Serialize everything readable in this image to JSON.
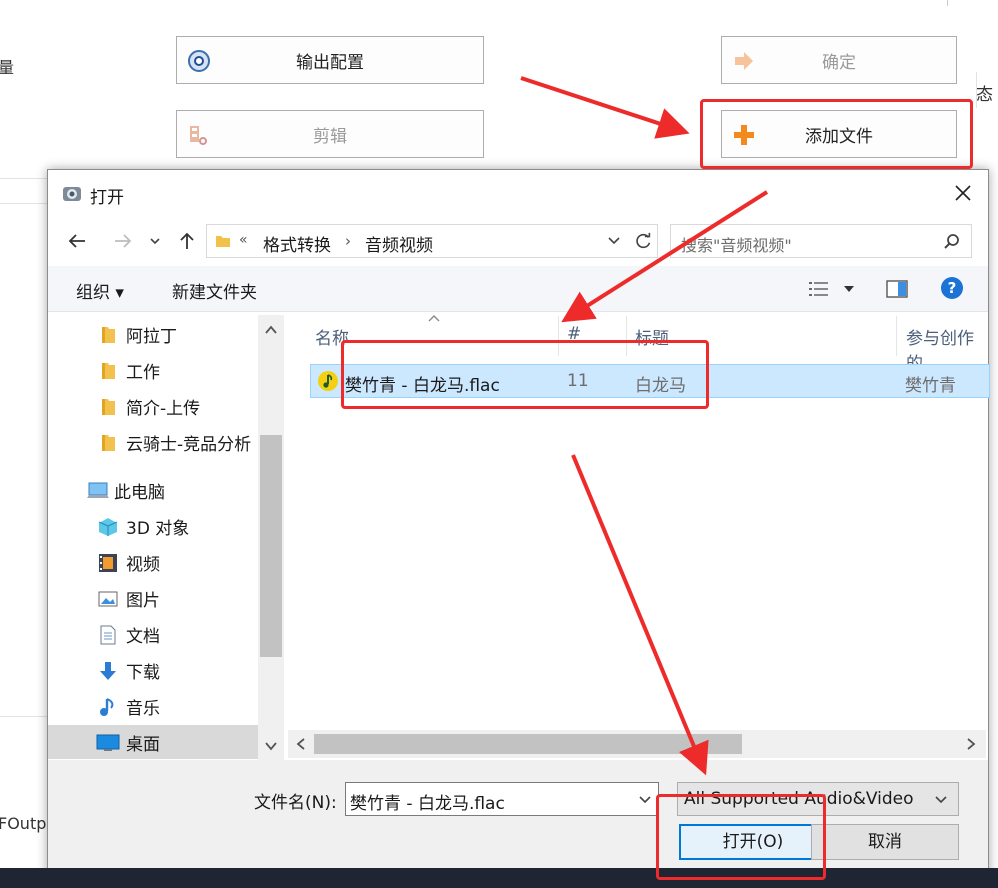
{
  "background_app": {
    "left_fragment_1": "量",
    "left_fragment_2": "",
    "right_fragment": "态",
    "bottom_left_fragment": "FOutpu",
    "buttons": {
      "output_config": "输出配置",
      "confirm": "确定",
      "clip": "剪辑",
      "add_file": "添加文件"
    }
  },
  "dialog": {
    "title": "打开",
    "address": {
      "overflow": "«",
      "crumbs": [
        "格式转换",
        "音频视频"
      ]
    },
    "search_placeholder": "搜索\"音频视频\"",
    "toolbar": {
      "organize": "组织 ▾",
      "new_folder": "新建文件夹"
    },
    "nav_items": [
      {
        "label": "阿拉丁",
        "icon": "folder-icon"
      },
      {
        "label": "工作",
        "icon": "folder-icon"
      },
      {
        "label": "简介-上传",
        "icon": "folder-icon"
      },
      {
        "label": "云骑士-竞品分析",
        "icon": "folder-icon"
      },
      {
        "label": "此电脑",
        "icon": "computer-icon"
      },
      {
        "label": "3D 对象",
        "icon": "3d-objects-icon"
      },
      {
        "label": "视频",
        "icon": "video-icon"
      },
      {
        "label": "图片",
        "icon": "pictures-icon"
      },
      {
        "label": "文档",
        "icon": "documents-icon"
      },
      {
        "label": "下载",
        "icon": "download-icon"
      },
      {
        "label": "音乐",
        "icon": "music-icon"
      },
      {
        "label": "桌面",
        "icon": "desktop-icon"
      }
    ],
    "columns": [
      "名称",
      "#",
      "标题",
      "参与创作的"
    ],
    "files": [
      {
        "name": "樊竹青 - 白龙马.flac",
        "number": "11",
        "title": "白龙马",
        "artist": "樊竹青",
        "icon": "audio-file-icon"
      }
    ],
    "filename_label": "文件名(N):",
    "filename_value": "樊竹青 - 白龙马.flac",
    "filter_value": "All Supported Audio&Video",
    "open_button": "打开(O)",
    "cancel_button": "取消"
  },
  "colors": {
    "annotation": "#ee2b2b",
    "selection": "#cce8ff",
    "accent": "#0078d7"
  }
}
